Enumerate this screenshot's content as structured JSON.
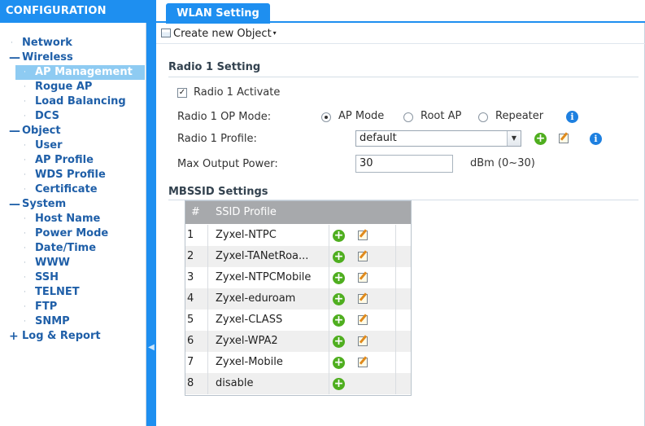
{
  "sidebar": {
    "header": "CONFIGURATION",
    "items": [
      {
        "label": "Network",
        "level": 0,
        "marker": "·"
      },
      {
        "label": "Wireless",
        "level": 0,
        "marker": "—"
      },
      {
        "label": "AP Management",
        "level": 1,
        "marker": "·",
        "selected": true
      },
      {
        "label": "Rogue AP",
        "level": 1,
        "marker": "·"
      },
      {
        "label": "Load Balancing",
        "level": 1,
        "marker": "·"
      },
      {
        "label": "DCS",
        "level": 1,
        "marker": "·"
      },
      {
        "label": "Object",
        "level": 0,
        "marker": "—"
      },
      {
        "label": "User",
        "level": 1,
        "marker": "·"
      },
      {
        "label": "AP Profile",
        "level": 1,
        "marker": "·"
      },
      {
        "label": "WDS Profile",
        "level": 1,
        "marker": "·"
      },
      {
        "label": "Certificate",
        "level": 1,
        "marker": "·"
      },
      {
        "label": "System",
        "level": 0,
        "marker": "—"
      },
      {
        "label": "Host Name",
        "level": 1,
        "marker": "·"
      },
      {
        "label": "Power Mode",
        "level": 1,
        "marker": "·"
      },
      {
        "label": "Date/Time",
        "level": 1,
        "marker": "·"
      },
      {
        "label": "WWW",
        "level": 1,
        "marker": "·"
      },
      {
        "label": "SSH",
        "level": 1,
        "marker": "·"
      },
      {
        "label": "TELNET",
        "level": 1,
        "marker": "·"
      },
      {
        "label": "FTP",
        "level": 1,
        "marker": "·"
      },
      {
        "label": "SNMP",
        "level": 1,
        "marker": "·"
      },
      {
        "label": "Log & Report",
        "level": 0,
        "marker": "+"
      }
    ]
  },
  "tabs": {
    "active": "WLAN Setting"
  },
  "toolbar": {
    "create_label": "Create new Object",
    "create_caret": "▾"
  },
  "radio1": {
    "section_title": "Radio 1 Setting",
    "activate_label": "Radio 1 Activate",
    "activate_checked": "✓",
    "op_mode_label": "Radio 1 OP Mode:",
    "op_modes": [
      "AP Mode",
      "Root AP",
      "Repeater"
    ],
    "op_mode_selected": "AP Mode",
    "profile_label": "Radio 1 Profile:",
    "profile_value": "default",
    "max_power_label": "Max Output Power:",
    "max_power_value": "30",
    "max_power_unit": "dBm (0~30)",
    "info_glyph": "i",
    "add_glyph": "+",
    "select_arrow": "▼"
  },
  "mbssid": {
    "section_title": "MBSSID Settings",
    "columns": {
      "num": "#",
      "profile": "SSID Profile"
    },
    "rows": [
      {
        "num": "1",
        "name": "Zyxel-NTPC",
        "editable": true
      },
      {
        "num": "2",
        "name": "Zyxel-TANetRoa...",
        "editable": true
      },
      {
        "num": "3",
        "name": "Zyxel-NTPCMobile",
        "editable": true
      },
      {
        "num": "4",
        "name": "Zyxel-eduroam",
        "editable": true
      },
      {
        "num": "5",
        "name": "Zyxel-CLASS",
        "editable": true
      },
      {
        "num": "6",
        "name": "Zyxel-WPA2",
        "editable": true
      },
      {
        "num": "7",
        "name": "Zyxel-Mobile",
        "editable": true
      },
      {
        "num": "8",
        "name": "disable",
        "editable": false
      }
    ]
  },
  "colors": {
    "brand_blue": "#1e8ff0",
    "nav_text": "#1f5fa8",
    "selected_bg": "#8ecbf2",
    "add_green": "#4fae1f",
    "info_blue": "#1e80e0",
    "table_header": "#a7a9ac"
  }
}
